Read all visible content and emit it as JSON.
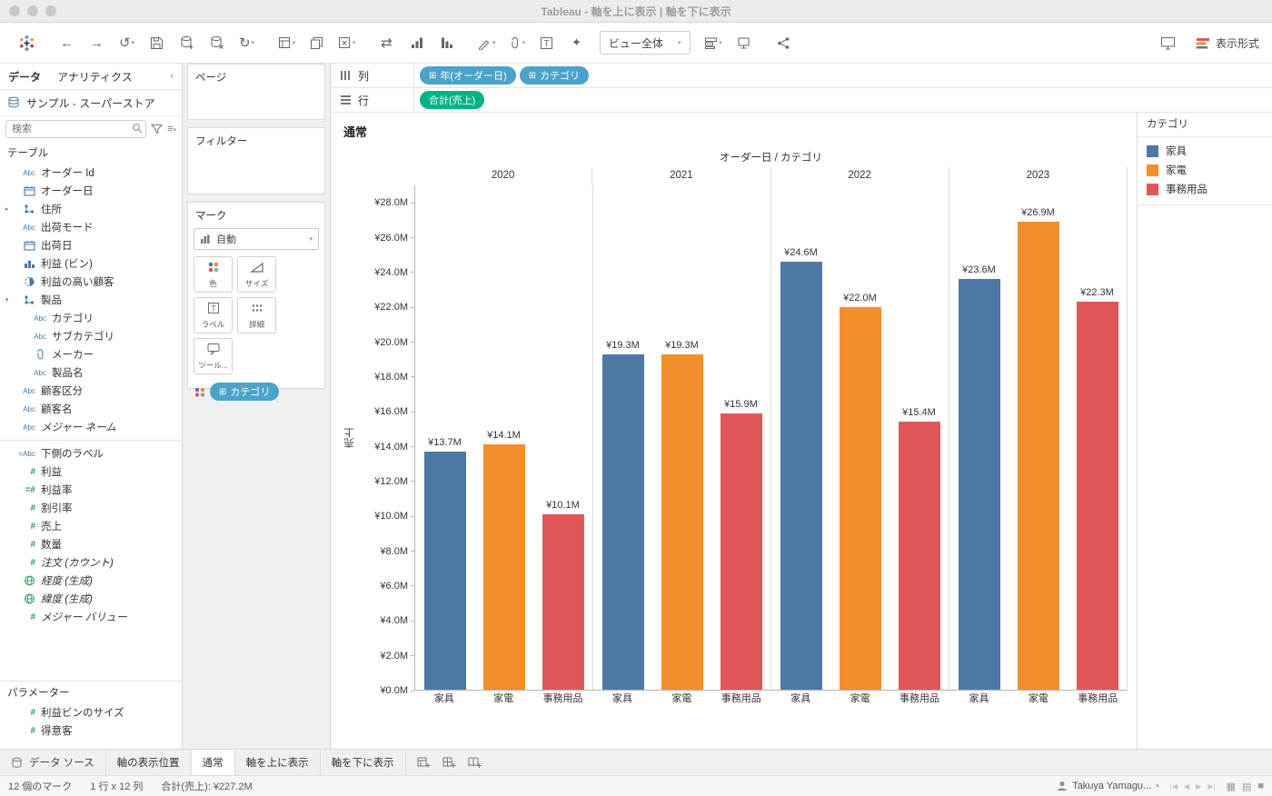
{
  "window": {
    "title": "Tableau - 軸を上に表示 | 軸を下に表示"
  },
  "toolbar": {
    "fit": "ビュー全体",
    "show_me": "表示形式"
  },
  "sidebar": {
    "tabs": [
      {
        "label": "データ"
      },
      {
        "label": "アナリティクス"
      }
    ],
    "datasource": "サンプル - スーパーストア",
    "search_placeholder": "検索",
    "tables_label": "テーブル",
    "fields": [
      {
        "label": "オーダー Id",
        "icon": "abc"
      },
      {
        "label": "オーダー日",
        "icon": "calendar"
      },
      {
        "label": "住所",
        "icon": "hierarchy",
        "expander": "collapsed"
      },
      {
        "label": "出荷モード",
        "icon": "abc"
      },
      {
        "label": "出荷日",
        "icon": "calendar"
      },
      {
        "label": "利益 (ビン)",
        "icon": "bin"
      },
      {
        "label": "利益の高い顧客",
        "icon": "set"
      },
      {
        "label": "製品",
        "icon": "hierarchy",
        "expander": "expanded"
      },
      {
        "label": "カテゴリ",
        "icon": "abc",
        "indent": 1
      },
      {
        "label": "サブカテゴリ",
        "icon": "abc",
        "indent": 1
      },
      {
        "label": "メーカー",
        "icon": "clip",
        "indent": 1
      },
      {
        "label": "製品名",
        "icon": "abc",
        "indent": 1
      },
      {
        "label": "顧客区分",
        "icon": "abc"
      },
      {
        "label": "顧客名",
        "icon": "abc"
      },
      {
        "label": "メジャー ネーム",
        "icon": "abc",
        "italic": true
      },
      {
        "label": "下側のラベル",
        "icon": "abc-calc",
        "separator_above": true
      },
      {
        "label": "利益",
        "icon": "num"
      },
      {
        "label": "利益率",
        "icon": "num-calc"
      },
      {
        "label": "割引率",
        "icon": "num"
      },
      {
        "label": "売上",
        "icon": "num"
      },
      {
        "label": "数量",
        "icon": "num"
      },
      {
        "label": "注文 (カウント)",
        "icon": "num",
        "italic": true
      },
      {
        "label": "経度 (生成)",
        "icon": "globe",
        "italic": true
      },
      {
        "label": "緯度 (生成)",
        "icon": "globe",
        "italic": true
      },
      {
        "label": "メジャー バリュー",
        "icon": "num",
        "italic": true
      }
    ],
    "parameters_label": "パラメーター",
    "parameters": [
      {
        "label": "利益ビンのサイズ",
        "icon": "num"
      },
      {
        "label": "得意客",
        "icon": "num"
      }
    ]
  },
  "cards": {
    "pages_label": "ページ",
    "filters_label": "フィルター"
  },
  "marks": {
    "title": "マーク",
    "type_dropdown": "自動",
    "buttons": [
      {
        "label": "色",
        "icon": "color"
      },
      {
        "label": "サイズ",
        "icon": "size"
      },
      {
        "label": "ラベル",
        "icon": "label"
      },
      {
        "label": "詳細",
        "icon": "detail"
      },
      {
        "label": "ツール...",
        "icon": "tooltip"
      }
    ],
    "pill": "カテゴリ"
  },
  "shelves": {
    "columns_label": "列",
    "rows_label": "行",
    "pill_colors": {
      "dimension": "#4BA3C9",
      "measure": "#00B385"
    },
    "columns_pills": [
      {
        "label": "年(オーダー日)"
      },
      {
        "label": "カテゴリ"
      }
    ],
    "rows_pills": [
      {
        "label": "合計(売上)"
      }
    ]
  },
  "sheet": {
    "title": "通常"
  },
  "legend": {
    "title": "カテゴリ",
    "items": [
      {
        "label": "家具",
        "color": "#4E79A7"
      },
      {
        "label": "家電",
        "color": "#F28E2B"
      },
      {
        "label": "事務用品",
        "color": "#E15759"
      }
    ]
  },
  "chart_data": {
    "type": "bar",
    "title": "オーダー日 / カテゴリ",
    "ylabel": "売上",
    "unit": "JPY millions",
    "ymax_m": 28,
    "ytick_step_m": 2,
    "yaxis_max_m": 29,
    "ytick_labels": [
      "¥28.0M",
      "¥26.0M",
      "¥24.0M",
      "¥22.0M",
      "¥20.0M",
      "¥18.0M",
      "¥16.0M",
      "¥14.0M",
      "¥12.0M",
      "¥10.0M",
      "¥8.0M",
      "¥6.0M",
      "¥4.0M",
      "¥2.0M",
      "¥0.0M"
    ],
    "years": [
      "2020",
      "2021",
      "2022",
      "2023"
    ],
    "categories": [
      "家具",
      "家電",
      "事務用品"
    ],
    "series": [
      {
        "name": "家具",
        "color": "#4E79A7",
        "values_m": [
          13.7,
          19.3,
          24.6,
          23.6
        ],
        "labels": [
          "¥13.7M",
          "¥19.3M",
          "¥24.6M",
          "¥23.6M"
        ]
      },
      {
        "name": "家電",
        "color": "#F28E2B",
        "values_m": [
          14.1,
          19.3,
          22.0,
          26.9
        ],
        "labels": [
          "¥14.1M",
          "¥19.3M",
          "¥22.0M",
          "¥26.9M"
        ]
      },
      {
        "name": "事務用品",
        "color": "#E15759",
        "values_m": [
          10.1,
          15.9,
          15.4,
          22.3
        ],
        "labels": [
          "¥10.1M",
          "¥15.9M",
          "¥15.4M",
          "¥22.3M"
        ]
      }
    ],
    "legend_position": "right",
    "gridlines": false
  },
  "bottom_bar": {
    "datasource_tab": "データ ソース",
    "sheet_tabs": [
      {
        "label": "軸の表示位置",
        "active": false
      },
      {
        "label": "通常",
        "active": true
      },
      {
        "label": "軸を上に表示",
        "active": false
      },
      {
        "label": "軸を下に表示",
        "active": false
      }
    ]
  },
  "status_bar": {
    "marks": "12 個のマーク",
    "dimensions": "1 行 x 12 列",
    "aggregate": "合計(売上): ¥227.2M",
    "user": "Takuya Yamagu..."
  }
}
